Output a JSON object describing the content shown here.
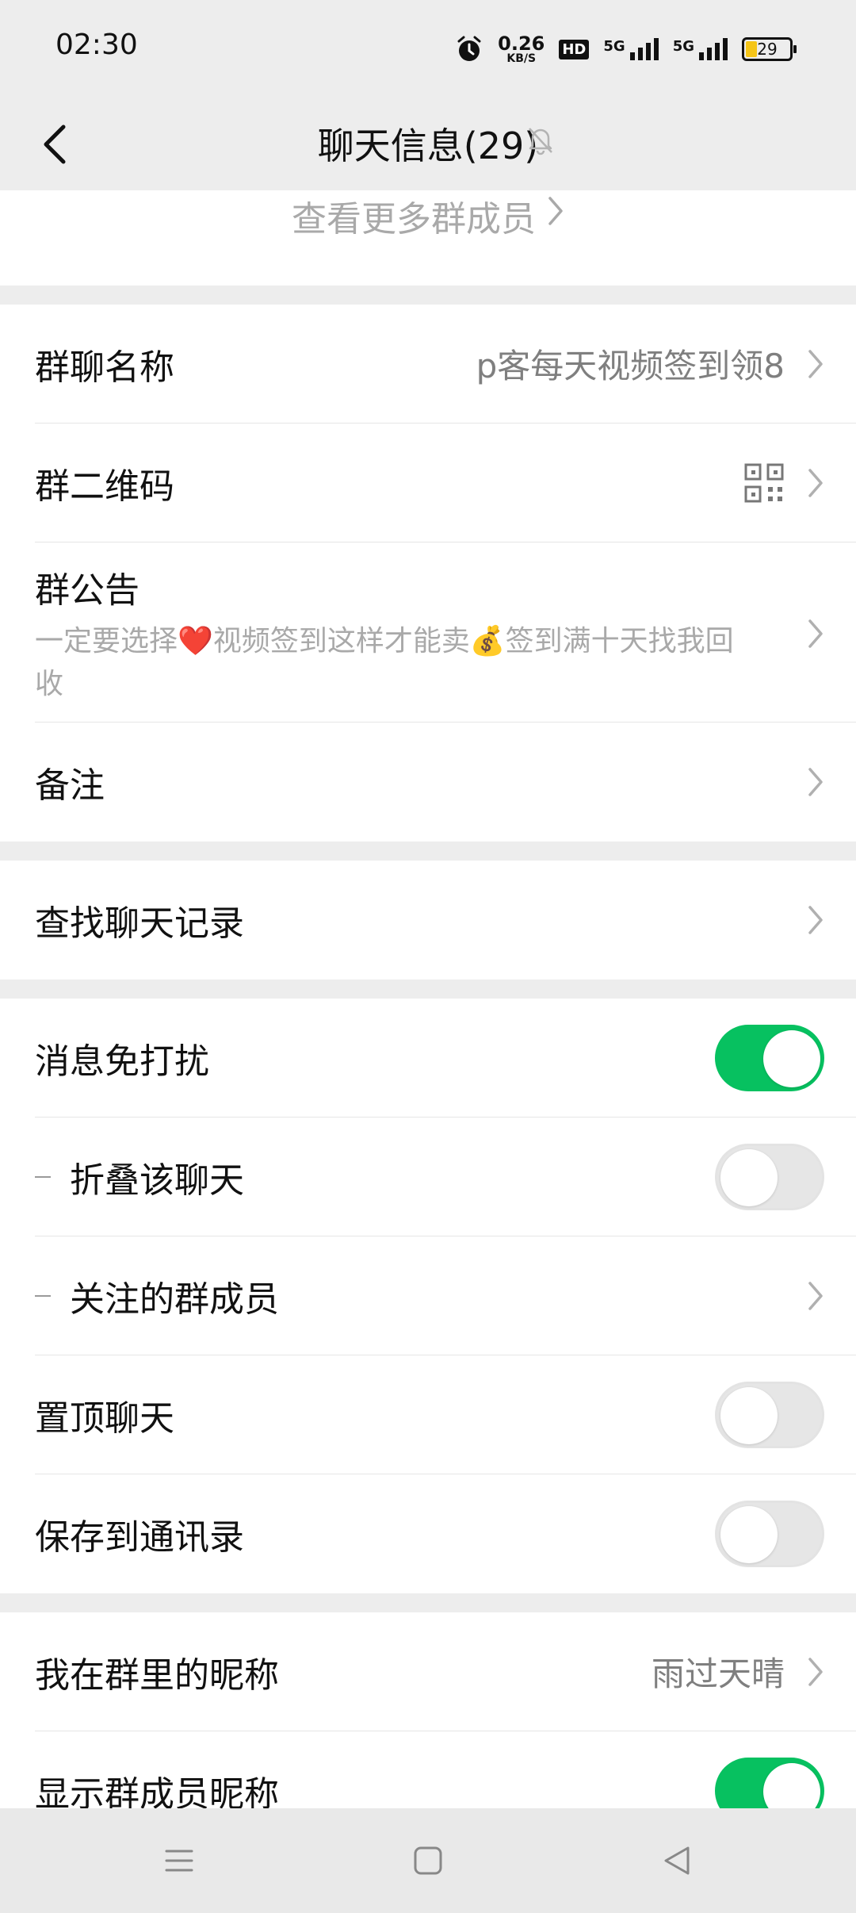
{
  "status_bar": {
    "time": "02:30",
    "speed_value": "0.26",
    "speed_unit": "KB/S",
    "hd_label": "HD",
    "net1_label": "5G",
    "net2_label": "5G",
    "battery": "29"
  },
  "header": {
    "title": "聊天信息(29)",
    "back_icon": "chevron-left-icon",
    "mute_icon": "bell-off-icon"
  },
  "members": {
    "more_label": "查看更多群成员"
  },
  "group_settings": {
    "name_label": "群聊名称",
    "name_value": "p客每天视频签到领8",
    "qrcode_label": "群二维码",
    "notice_label": "群公告",
    "notice_text": "一定要选择❤️视频签到这样才能卖💰签到满十天找我回收",
    "remark_label": "备注"
  },
  "search": {
    "label": "查找聊天记录"
  },
  "toggles": {
    "mute_label": "消息免打扰",
    "mute_on": true,
    "fold_label": "折叠该聊天",
    "fold_on": false,
    "follow_label": "关注的群成员",
    "pin_label": "置顶聊天",
    "pin_on": false,
    "save_label": "保存到通讯录",
    "save_on": false
  },
  "nickname": {
    "my_nick_label": "我在群里的昵称",
    "my_nick_value": "雨过天晴",
    "show_nick_label": "显示群成员昵称",
    "show_nick_on": true
  },
  "colors": {
    "accent_green": "#07c160",
    "background": "#ededed"
  }
}
